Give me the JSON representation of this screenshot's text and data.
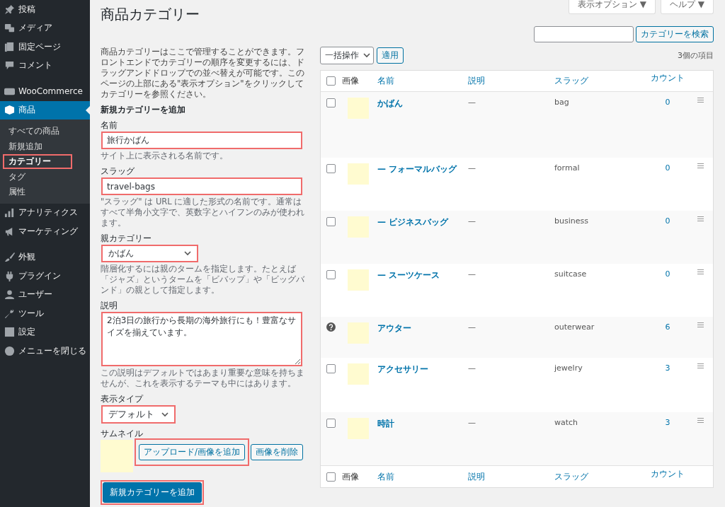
{
  "sidebar": {
    "groups": [
      [
        {
          "label": "投稿",
          "current": false
        },
        {
          "label": "メディア",
          "current": false
        },
        {
          "label": "固定ページ",
          "current": false
        },
        {
          "label": "コメント",
          "current": false
        }
      ],
      [
        {
          "label": "WooCommerce",
          "current": false
        },
        {
          "label": "商品",
          "current": true,
          "children": [
            {
              "label": "すべての商品",
              "selected": false,
              "highlighted": false
            },
            {
              "label": "新規追加",
              "selected": false,
              "highlighted": false
            },
            {
              "label": "カテゴリー",
              "selected": true,
              "highlighted": true
            },
            {
              "label": "タグ",
              "selected": false,
              "highlighted": false
            },
            {
              "label": "属性",
              "selected": false,
              "highlighted": false
            }
          ]
        },
        {
          "label": "アナリティクス",
          "current": false
        },
        {
          "label": "マーケティング",
          "current": false
        }
      ],
      [
        {
          "label": "外観",
          "current": false
        },
        {
          "label": "プラグイン",
          "current": false
        },
        {
          "label": "ユーザー",
          "current": false
        },
        {
          "label": "ツール",
          "current": false
        },
        {
          "label": "設定",
          "current": false
        },
        {
          "label": "メニューを閉じる",
          "current": false
        }
      ]
    ]
  },
  "screen_tabs": [
    {
      "label": "表示オプション ▼"
    },
    {
      "label": "ヘルプ ▼"
    }
  ],
  "page_title": "商品カテゴリー",
  "search": {
    "button": "カテゴリーを検索"
  },
  "form": {
    "intro": "商品カテゴリーはここで管理することができます。フロントエンドでカテゴリーの順序を変更するには、ドラッグアンドドロップでの並べ替えが可能です。このページの上部にある\"表示オプション\"をクリックしてカテゴリーを参照ください。",
    "heading": "新規カテゴリーを追加",
    "fields": [
      {
        "kind": "text",
        "label": "名前",
        "value": "旅行かばん",
        "help": "サイト上に表示される名前です。",
        "highlighted": true
      },
      {
        "kind": "text",
        "label": "スラッグ",
        "value": "travel-bags",
        "help": "\"スラッグ\" は URL に適した形式の名前です。通常はすべて半角小文字で、英数字とハイフンのみが使われます。",
        "highlighted": true
      },
      {
        "kind": "select",
        "label": "親カテゴリー",
        "value": "かばん",
        "help": "階層化するには親のタームを指定します。たとえば「ジャズ」というタームを「ビバップ」や「ビッグバンド」の親として指定します。",
        "highlighted": true
      },
      {
        "kind": "textarea",
        "label": "説明",
        "value": "2泊3日の旅行から長期の海外旅行にも！豊富なサイズを揃えています。",
        "help": "この説明はデフォルトではあまり重要な意味を持ちませんが、これを表示するテーマも中にはあります。",
        "highlighted": true
      },
      {
        "kind": "select-small",
        "label": "表示タイプ",
        "value": "デフォルト",
        "highlighted": true
      },
      {
        "kind": "thumbnail",
        "label": "サムネイル",
        "upload": "アップロード/画像を追加",
        "upload_highlighted": true,
        "remove": "画像を削除"
      }
    ],
    "submit": "新規カテゴリーを追加",
    "submit_highlighted": true
  },
  "toolbar": {
    "bulk": "一括操作",
    "apply": "適用",
    "count": "3個の項目"
  },
  "table": {
    "header_checked": false,
    "columns": [
      "画像",
      "名前",
      "説明",
      "スラッグ",
      "カウント"
    ],
    "rows": [
      {
        "kind": "normal",
        "checked": false,
        "name": "かばん",
        "description": "—",
        "slug": "bag",
        "count": "0"
      },
      {
        "kind": "normal",
        "checked": false,
        "name": "— フォーマルバッグ",
        "description": "—",
        "slug": "formal",
        "count": "0"
      },
      {
        "kind": "normal",
        "checked": false,
        "name": "— ビジネスバッグ",
        "description": "—",
        "slug": "business",
        "count": "0"
      },
      {
        "kind": "normal",
        "checked": false,
        "name": "— スーツケース",
        "description": "—",
        "slug": "suitcase",
        "count": "0"
      },
      {
        "kind": "default",
        "name": "アウター",
        "description": "—",
        "slug": "outerwear",
        "count": "6"
      },
      {
        "kind": "normal",
        "checked": false,
        "name": "アクセサリー",
        "description": "—",
        "slug": "jewelry",
        "count": "3"
      },
      {
        "kind": "normal",
        "checked": false,
        "name": "時計",
        "description": "—",
        "slug": "watch",
        "count": "3"
      }
    ],
    "footer_checked": false,
    "footer_columns": [
      "画像",
      "名前",
      "説明",
      "スラッグ",
      "カウント"
    ]
  }
}
